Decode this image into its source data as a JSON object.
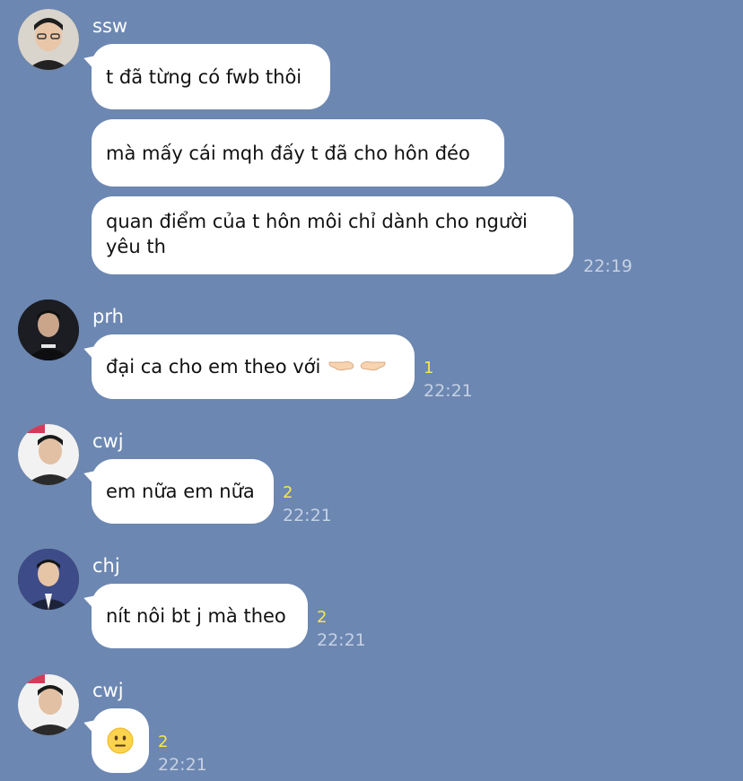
{
  "colors": {
    "background": "#6c87b1",
    "bubble": "#ffffff",
    "read_count": "#f5e94a",
    "timestamp": "#c6d1e4",
    "sender": "#ffffff"
  },
  "messages": [
    {
      "sender": "ssw",
      "avatar": "ssw-avatar",
      "bubbles": [
        "t đã từng có fwb thôi",
        "mà mấy cái mqh đấy t đã cho hôn đéo",
        "quan điểm của t hôn môi chỉ dành cho người yêu th"
      ],
      "time": "22:19"
    },
    {
      "sender": "prh",
      "avatar": "prh-avatar",
      "bubbles": [
        "đại ca cho em theo với"
      ],
      "emoji": "pointing-hands-emoji",
      "read_count": "1",
      "time": "22:21"
    },
    {
      "sender": "cwj",
      "avatar": "cwj-avatar",
      "bubbles": [
        "em nữa em nữa"
      ],
      "read_count": "2",
      "time": "22:21"
    },
    {
      "sender": "chj",
      "avatar": "chj-avatar",
      "bubbles": [
        "nít nôi bt j mà theo"
      ],
      "read_count": "2",
      "time": "22:21"
    },
    {
      "sender": "cwj",
      "avatar": "cwj-avatar",
      "emoji": "neutral-face-emoji",
      "read_count": "2",
      "time": "22:21"
    }
  ]
}
